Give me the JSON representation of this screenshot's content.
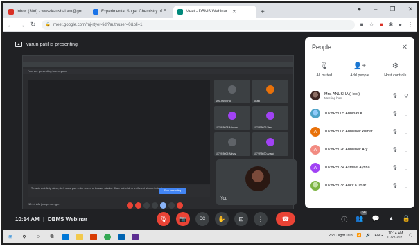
{
  "browser": {
    "tabs": [
      {
        "label": "Inbox (306) - www.kaushal.vm@gm...",
        "color": "#d93025",
        "active": false
      },
      {
        "label": "Experimental Sugar Chemistry of F...",
        "color": "#1a73e8",
        "active": false
      },
      {
        "label": "Meet - DBMS Webinar",
        "color": "#00897b",
        "active": true
      }
    ],
    "new_tab": "+",
    "url": "meet.google.com/rnj-rtyer-tidl?authuser=0&pli=1"
  },
  "meet": {
    "presenting_label": "varun patil is presenting",
    "shared_screen": {
      "meeting_bar_text": "You are presenting to everyone",
      "notice_text": "To avoid an infinity mirror, don't share your entire screen or browser window. Share just a tab or a different window instead.",
      "notice_button": "Stop presenting",
      "time_text": "10:14 AM | mqp-rrpe-fgm",
      "tiles": [
        {
          "name": "Mrs. ANUSHA",
          "color": "#5f6368"
        },
        {
          "name": "Sruthi",
          "color": "#e8710a"
        },
        {
          "name": "107YR5028 Ashwani",
          "color": "#a142f4"
        },
        {
          "name": "107YR5026 Vasu",
          "color": "#a142f4"
        },
        {
          "name": "107YR5005 Abhay",
          "color": "#5f6368"
        },
        {
          "name": "107YR5030 Anand",
          "color": "#a142f4"
        }
      ]
    },
    "self_view": {
      "name": "You",
      "more": "⋮"
    },
    "meeting_time": "10:14 AM",
    "separator": "|",
    "meeting_name": "DBMS Webinar",
    "controls": {
      "mic": "🎙",
      "camera": "📷",
      "captions": "CC",
      "raise_hand": "✋",
      "present": "⊡",
      "more": "⋮",
      "end_call": "☎"
    },
    "right_controls": {
      "info": "ⓘ",
      "people": "👥",
      "people_count": "68",
      "chat": "💬",
      "activities": "▲",
      "lock": "🔒"
    }
  },
  "people_panel": {
    "title": "People",
    "close": "✕",
    "actions": [
      {
        "icon": "🎙",
        "label": "All muted"
      },
      {
        "icon": "👤+",
        "label": "Add people"
      },
      {
        "icon": "⚙",
        "label": "Host controls"
      }
    ],
    "participants": [
      {
        "name": "Mrs. ANUSHA (Host)",
        "sub": "Meeting host",
        "initial": "",
        "color": "#5f6368",
        "photo": true
      },
      {
        "name": "107YR5005 Abhinav K",
        "sub": "",
        "initial": "",
        "color": "#4fa3c7",
        "photo": true
      },
      {
        "name": "107YR5008 Abhishek kumar",
        "sub": "",
        "initial": "A",
        "color": "#e8710a",
        "photo": false
      },
      {
        "name": "107YR5026 Abhishek Ary...",
        "sub": "",
        "initial": "A",
        "color": "#f28b82",
        "photo": false
      },
      {
        "name": "107YR5034 Asmeet Ayrina",
        "sub": "",
        "initial": "A",
        "color": "#a142f4",
        "photo": false
      },
      {
        "name": "107YR5038 Ankit Kumar",
        "sub": "",
        "initial": "",
        "color": "#7cb342",
        "photo": true
      }
    ]
  },
  "taskbar": {
    "tray_weather": "26°C light rain",
    "time": "10:14 AM",
    "date": "11/27/2021",
    "lang": "ENG"
  }
}
